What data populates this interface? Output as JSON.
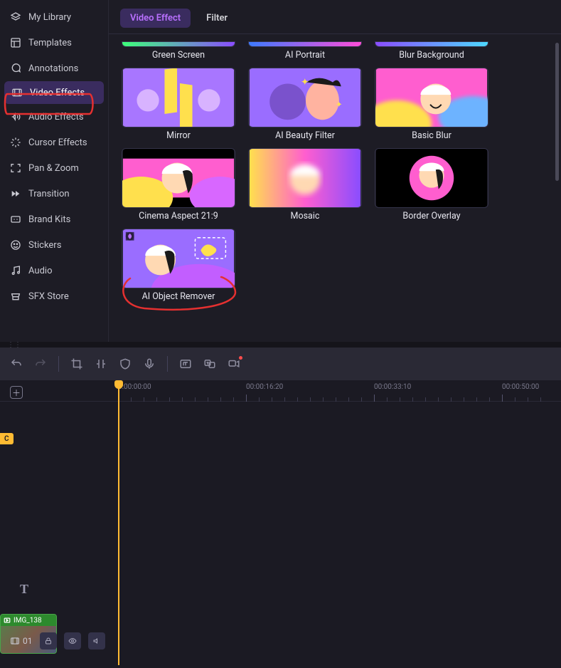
{
  "sidebar": {
    "items": [
      {
        "label": "My Library"
      },
      {
        "label": "Templates"
      },
      {
        "label": "Annotations"
      },
      {
        "label": "Video Effects"
      },
      {
        "label": "Audio Effects"
      },
      {
        "label": "Cursor Effects"
      },
      {
        "label": "Pan & Zoom"
      },
      {
        "label": "Transition"
      },
      {
        "label": "Brand Kits"
      },
      {
        "label": "Stickers"
      },
      {
        "label": "Audio"
      },
      {
        "label": "SFX Store"
      }
    ]
  },
  "tabs": {
    "video_effect": "Video Effect",
    "filter": "Filter"
  },
  "effects": [
    {
      "label": "Green Screen"
    },
    {
      "label": "AI Portrait"
    },
    {
      "label": "Blur Background"
    },
    {
      "label": "Mirror"
    },
    {
      "label": "AI Beauty Filter"
    },
    {
      "label": "Basic Blur"
    },
    {
      "label": "Cinema Aspect 21:9"
    },
    {
      "label": "Mosaic"
    },
    {
      "label": "Border Overlay"
    },
    {
      "label": "AI Object Remover"
    }
  ],
  "timeline": {
    "ruler": [
      "0:00:00:00",
      "00:00:16:20",
      "00:00:33:10",
      "00:00:50:00"
    ],
    "clip_pill": "C",
    "video_clip_name": "IMG_138",
    "track_count": "01"
  }
}
